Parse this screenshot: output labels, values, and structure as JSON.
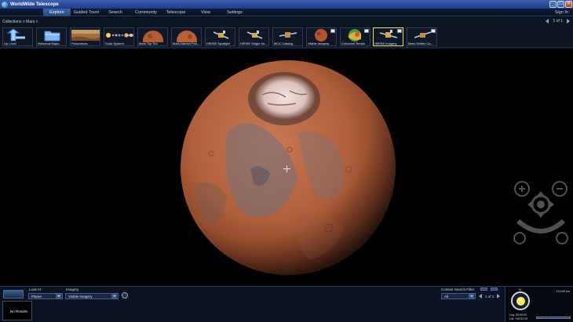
{
  "window": {
    "title": "WorldWide Telescope",
    "controls": [
      "minimize-icon",
      "maximize-icon",
      "close-icon"
    ]
  },
  "menu": {
    "items": [
      {
        "label": "Explore",
        "active": true
      },
      {
        "label": "Guided Tours",
        "active": false
      },
      {
        "label": "Search",
        "active": false
      },
      {
        "label": "Community",
        "active": false
      },
      {
        "label": "Telescope",
        "active": false
      },
      {
        "label": "View",
        "active": false
      },
      {
        "label": "Settings",
        "active": false
      }
    ],
    "signin": "Sign In"
  },
  "collections": {
    "breadcrumb": "Collections  > Mars  >",
    "page": "1 of 1"
  },
  "thumbnails": [
    {
      "label": "Up Level",
      "kind": "up"
    },
    {
      "label": "Historical Maps",
      "kind": "folder"
    },
    {
      "label": "Panoramas",
      "kind": "pano"
    },
    {
      "label": "Solar System",
      "kind": "solar"
    },
    {
      "label": "Mars Top Ten",
      "kind": "mars"
    },
    {
      "label": "Mars Named Fea...",
      "kind": "mars"
    },
    {
      "label": "HiRISE Spotlight",
      "kind": "sat"
    },
    {
      "label": "HiRISE Single Im...",
      "kind": "sat"
    },
    {
      "label": "MOC Catalog",
      "kind": "sat"
    },
    {
      "label": "Visible Imagery",
      "kind": "redplanet",
      "corner": true
    },
    {
      "label": "Colorized Terrain",
      "kind": "terrain",
      "corner": true
    },
    {
      "label": "HiRISE Imagery",
      "kind": "sat",
      "corner": true,
      "selected": true
    },
    {
      "label": "Mars Orbiter Ca...",
      "kind": "sat",
      "corner": true
    }
  ],
  "bottom": {
    "look_at_label": "Look At",
    "look_at_value": "Planet",
    "imagery_label": "Imagery",
    "imagery_value": "Visible Imagery",
    "no_results": "No Results",
    "context_filter_label": "Context Search Filter",
    "context_filter_value": "All",
    "context_page": "1 of 1"
  },
  "info": {
    "north": "N",
    "fov": "13,049 km",
    "lng": "Lng:    00:00:00",
    "lat": "Lat:    +90:52:29"
  },
  "colors": {
    "menu_active": "#3e66a8",
    "selected_thumb": "#e9e06a",
    "sun": "#f1e000"
  }
}
